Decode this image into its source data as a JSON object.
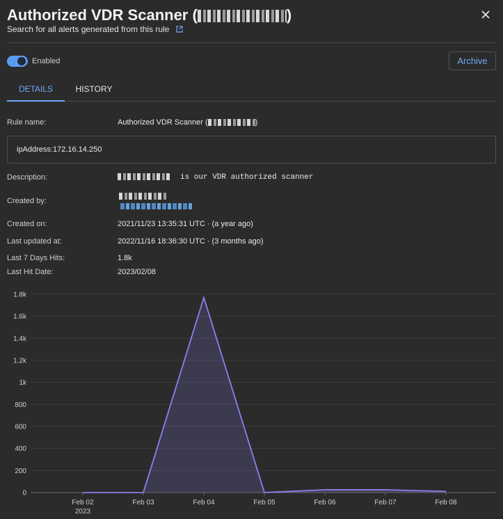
{
  "header": {
    "title": "Authorized VDR Scanner (",
    "title_close": ")",
    "subtitle": "Search for all alerts generated from this rule"
  },
  "status": {
    "toggle_label": "Enabled",
    "enabled": true,
    "archive_label": "Archive"
  },
  "tabs": [
    {
      "label": "DETAILS",
      "active": true
    },
    {
      "label": "HISTORY",
      "active": false
    }
  ],
  "details": {
    "rule_name_label": "Rule name:",
    "rule_name_value": "Authorized VDR Scanner (",
    "rule_name_close": ")",
    "query": "ipAddress:172.16.14.250",
    "description_label": "Description:",
    "description_value": "is our VDR authorized scanner",
    "created_by_label": "Created by:",
    "created_on_label": "Created on:",
    "created_on_value": "2021/11/23 13:35:31 UTC · (a year ago)",
    "last_updated_label": "Last updated at:",
    "last_updated_value": "2022/11/16 18:36:30 UTC · (3 months ago)",
    "hits_label": "Last 7 Days Hits:",
    "hits_value": "1.8k",
    "last_hit_label": "Last Hit Date:",
    "last_hit_value": "2023/02/08"
  },
  "colors": {
    "accent": "#6fa8f5",
    "series": "#8b80f0",
    "background": "#2b2b2b"
  },
  "chart_data": {
    "type": "area",
    "x": [
      "Feb 02",
      "Feb 03",
      "Feb 04",
      "Feb 05",
      "Feb 06",
      "Feb 07",
      "Feb 08"
    ],
    "x_year_label": "2023",
    "values": [
      0,
      0,
      1770,
      0,
      25,
      25,
      10
    ],
    "y_ticks": [
      "0",
      "200",
      "400",
      "600",
      "800",
      "1k",
      "1.2k",
      "1.4k",
      "1.6k",
      "1.8k"
    ],
    "ylim": [
      0,
      1800
    ],
    "grid": true
  }
}
